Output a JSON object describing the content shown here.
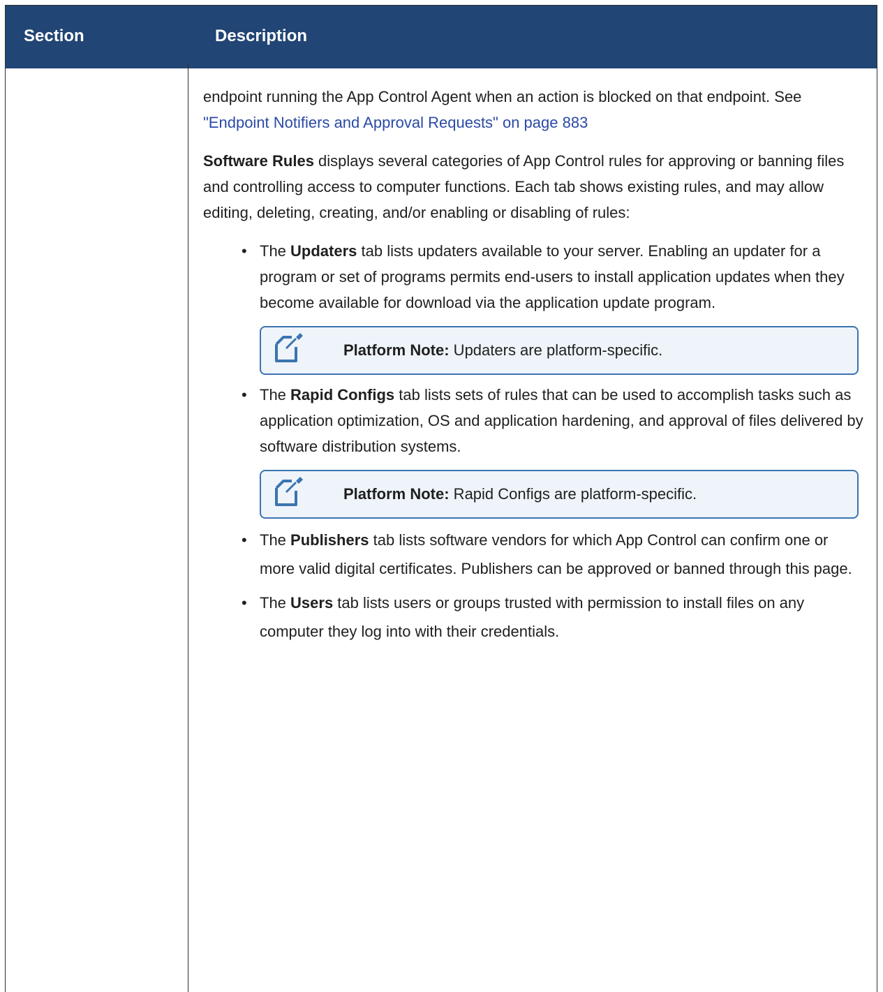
{
  "header": {
    "col_section": "Section",
    "col_description": "Description"
  },
  "para1": {
    "text": "endpoint running the App Control Agent when an action is blocked on that endpoint. See ",
    "link": "\"Endpoint Notifiers and Approval Requests\" on page 883"
  },
  "para2": {
    "bold": "Software Rules",
    "text": " displays several categories of App Control rules for approving or banning files and controlling access to computer functions. Each tab shows existing rules, and may allow editing, deleting, creating, and/or enabling or disabling of rules:"
  },
  "bullets": [
    {
      "pre": "The ",
      "bold": "Updaters",
      "text": " tab lists updaters available to your server. Enabling an updater for a program or set of programs permits end-users to install application updates when they become available for download via the application update program.",
      "note": {
        "label": "Platform Note:",
        "text": " Updaters are platform-specific."
      }
    },
    {
      "pre": "The ",
      "bold": "Rapid Configs",
      "text": " tab lists sets of rules that can be used to accomplish tasks such as application optimization, OS and application hardening, and approval of files delivered by software distribution systems.",
      "note": {
        "label": "Platform Note:",
        "text": " Rapid Configs are platform-specific."
      }
    },
    {
      "pre": "The ",
      "bold": "Publishers",
      "text": " tab lists software vendors for which App Control can confirm one or more valid digital certificates. Publishers can be approved or banned through this page."
    },
    {
      "pre": "The ",
      "bold": "Users",
      "text": " tab lists users or groups trusted with permission to install files on any computer they log into with their credentials."
    }
  ],
  "colors": {
    "header_bg": "#214574",
    "link": "#2a4aa6",
    "note_border": "#3b74b0",
    "note_bg": "#eef4f9"
  },
  "icons": {
    "note_icon": "note-pencil-icon"
  }
}
